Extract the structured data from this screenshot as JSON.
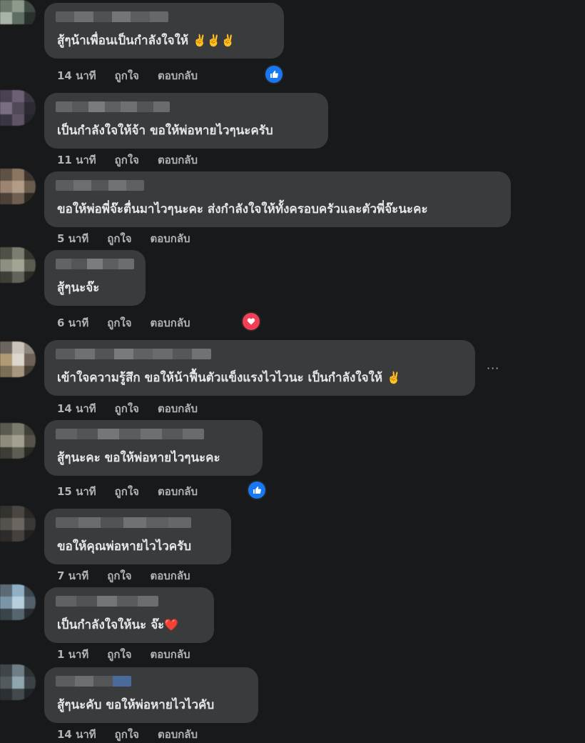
{
  "actions": {
    "like": "ถูกใจ",
    "reply": "ตอบกลับ"
  },
  "colors": {
    "background": "#18191a",
    "bubble": "#3a3b3c",
    "meta": "#b0b3b8",
    "like": "#1877f2",
    "love": "#f33e58"
  },
  "comments": [
    {
      "text": "สู้ๆน้าเพื่อนเป็นกำลังใจให้",
      "emoji": "✌️✌️✌️",
      "time": "14 นาที",
      "reaction": "like"
    },
    {
      "text": "เป็นกำลังใจให้จ้า ขอให้พ่อหายไวๆนะครับ",
      "emoji": "",
      "time": "11 นาที",
      "reaction": ""
    },
    {
      "text": "ขอให้พ่อพี่จ๊ะตื่นมาไวๆนะคะ ส่งกำลังใจให้ทั้งครอบครัวและตัวพี่จ๊ะนะคะ",
      "emoji": "",
      "time": "5 นาที",
      "reaction": ""
    },
    {
      "text": "สู้ๆนะจ๊ะ",
      "emoji": "",
      "time": "6 นาที",
      "reaction": "love"
    },
    {
      "text": "เข้าใจความรู้สึก ขอให้น้าฟื้นตัวแข็งแรงไวไวนะ เป็นกำลังใจให้",
      "emoji": "✌️",
      "time": "14 นาที",
      "reaction": "",
      "more": "···"
    },
    {
      "text": "สู้ๆนะคะ ขอให้พ่อหายไวๆนะคะ",
      "emoji": "",
      "time": "15 นาที",
      "reaction": "like"
    },
    {
      "text": "ขอให้คุณพ่อหายไวไวครับ",
      "emoji": "",
      "time": "7 นาที",
      "reaction": ""
    },
    {
      "text": "เป็นกำลังใจให้นะ จ๊ะ",
      "emoji": "❤️",
      "time": "1 นาที",
      "reaction": ""
    },
    {
      "text": "สู้ๆนะคับ ขอให้พ่อหายไวไวคับ",
      "emoji": "",
      "time": "14 นาที",
      "reaction": ""
    }
  ]
}
